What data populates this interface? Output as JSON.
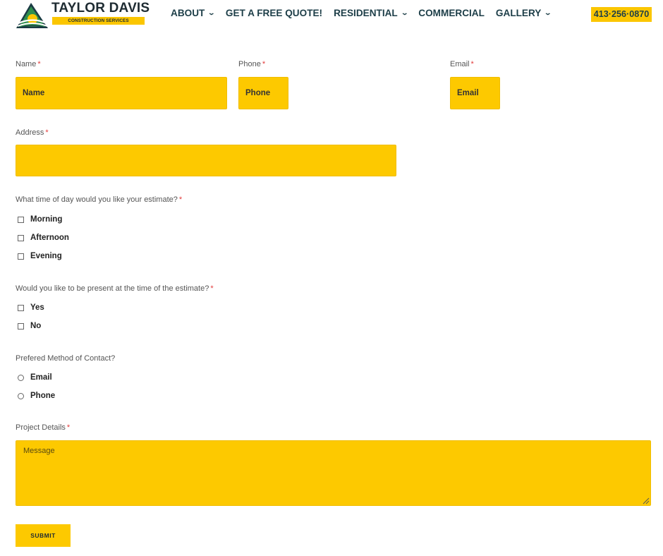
{
  "header": {
    "brand_name": "TAYLOR DAVIS",
    "brand_tagline": "CONSTRUCTION SERVICES",
    "nav": [
      {
        "label": "ABOUT",
        "has_dropdown": true
      },
      {
        "label": "GET A FREE QUOTE!",
        "has_dropdown": false
      },
      {
        "label": "RESIDENTIAL",
        "has_dropdown": true
      },
      {
        "label": "COMMERCIAL",
        "has_dropdown": false
      },
      {
        "label": "GALLERY",
        "has_dropdown": true
      }
    ],
    "caret": "⌄",
    "phone": "413·256·0870"
  },
  "form": {
    "required_mark": "*",
    "name": {
      "label": "Name",
      "placeholder": "Name"
    },
    "phone": {
      "label": "Phone",
      "placeholder": "Phone"
    },
    "email": {
      "label": "Email",
      "placeholder": "Email"
    },
    "address": {
      "label": "Address",
      "placeholder": ""
    },
    "time_question": "What time of day would you like your estimate?",
    "time_options": [
      "Morning",
      "Afternoon",
      "Evening"
    ],
    "present_question": "Would you like to be present at the time of the estimate?",
    "present_options": [
      "Yes",
      "No"
    ],
    "contact_question": "Prefered Method of Contact?",
    "contact_options": [
      "Email",
      "Phone"
    ],
    "details": {
      "label": "Project Details",
      "placeholder": "Message"
    },
    "submit_label": "SUBMIT"
  },
  "colors": {
    "accent": "#fdc900",
    "nav_text": "#1d3e48",
    "required": "#e23b3b"
  },
  "icons": [
    "logo-mountain-sun-icon",
    "chevron-down-icon",
    "checkbox-icon",
    "radio-icon",
    "resize-grip-icon"
  ]
}
